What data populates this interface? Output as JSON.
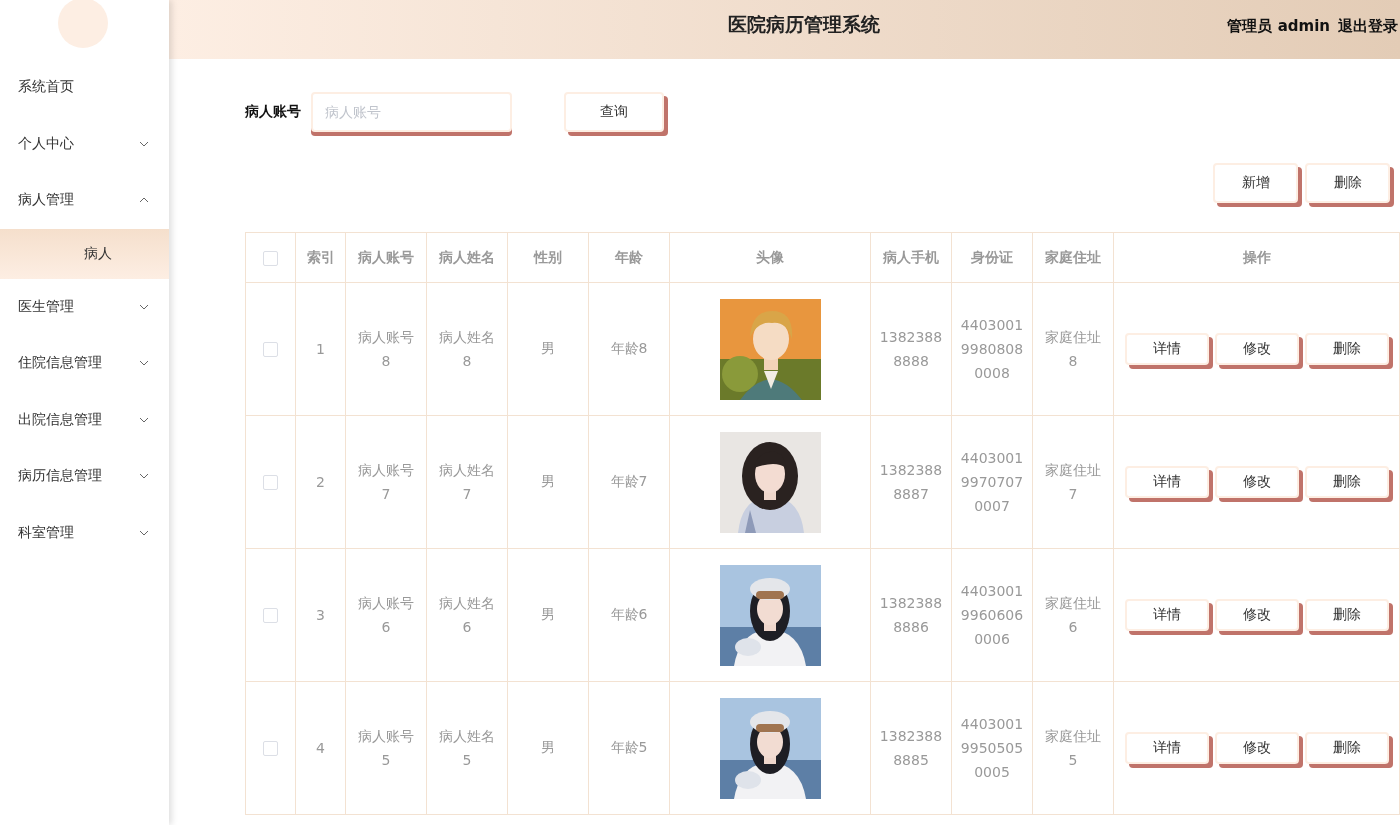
{
  "header": {
    "title": "医院病历管理系统",
    "user": "管理员 admin",
    "logout": "退出登录"
  },
  "sidebar": {
    "items": [
      {
        "label": "系统首页",
        "kind": "link"
      },
      {
        "label": "个人中心",
        "kind": "menu",
        "expanded": false
      },
      {
        "label": "病人管理",
        "kind": "menu",
        "expanded": true,
        "children": [
          {
            "label": "病人",
            "selected": true
          }
        ]
      },
      {
        "label": "医生管理",
        "kind": "menu",
        "expanded": false
      },
      {
        "label": "住院信息管理",
        "kind": "menu",
        "expanded": false
      },
      {
        "label": "出院信息管理",
        "kind": "menu",
        "expanded": false
      },
      {
        "label": "病历信息管理",
        "kind": "menu",
        "expanded": false
      },
      {
        "label": "科室管理",
        "kind": "menu",
        "expanded": false
      }
    ]
  },
  "search": {
    "label": "病人账号",
    "placeholder": "病人账号",
    "button": "查询"
  },
  "toolbar": {
    "buttons": [
      "新增",
      "删除"
    ]
  },
  "table": {
    "select_all": {
      "checked": false
    },
    "columns": [
      "索引",
      "病人账号",
      "病人姓名",
      "性别",
      "年龄",
      "头像",
      "病人手机",
      "身份证",
      "家庭住址",
      "操作"
    ],
    "rows": [
      {
        "checked": false,
        "index": "1",
        "account": "病人账号8",
        "name": "病人姓名8",
        "gender": "男",
        "age": "年龄8",
        "avatar": {
          "kind": "picture"
        },
        "phone": "13823888888",
        "id_card": "440300199808080008",
        "address": "家庭住址8",
        "actions": [
          "详情",
          "修改",
          "删除"
        ]
      },
      {
        "checked": false,
        "index": "2",
        "account": "病人账号7",
        "name": "病人姓名7",
        "gender": "男",
        "age": "年龄7",
        "avatar": {
          "kind": "picture"
        },
        "phone": "13823888887",
        "id_card": "440300199707070007",
        "address": "家庭住址7",
        "actions": [
          "详情",
          "修改",
          "删除"
        ]
      },
      {
        "checked": false,
        "index": "3",
        "account": "病人账号6",
        "name": "病人姓名6",
        "gender": "男",
        "age": "年龄6",
        "avatar": {
          "kind": "picture"
        },
        "phone": "13823888886",
        "id_card": "440300199606060006",
        "address": "家庭住址6",
        "actions": [
          "详情",
          "修改",
          "删除"
        ]
      },
      {
        "checked": false,
        "index": "4",
        "account": "病人账号5",
        "name": "病人姓名5",
        "gender": "男",
        "age": "年龄5",
        "avatar": {
          "kind": "picture"
        },
        "phone": "13823888885",
        "id_card": "440300199505050005",
        "address": "家庭住址5",
        "actions": [
          "详情",
          "修改",
          "删除"
        ]
      }
    ]
  }
}
